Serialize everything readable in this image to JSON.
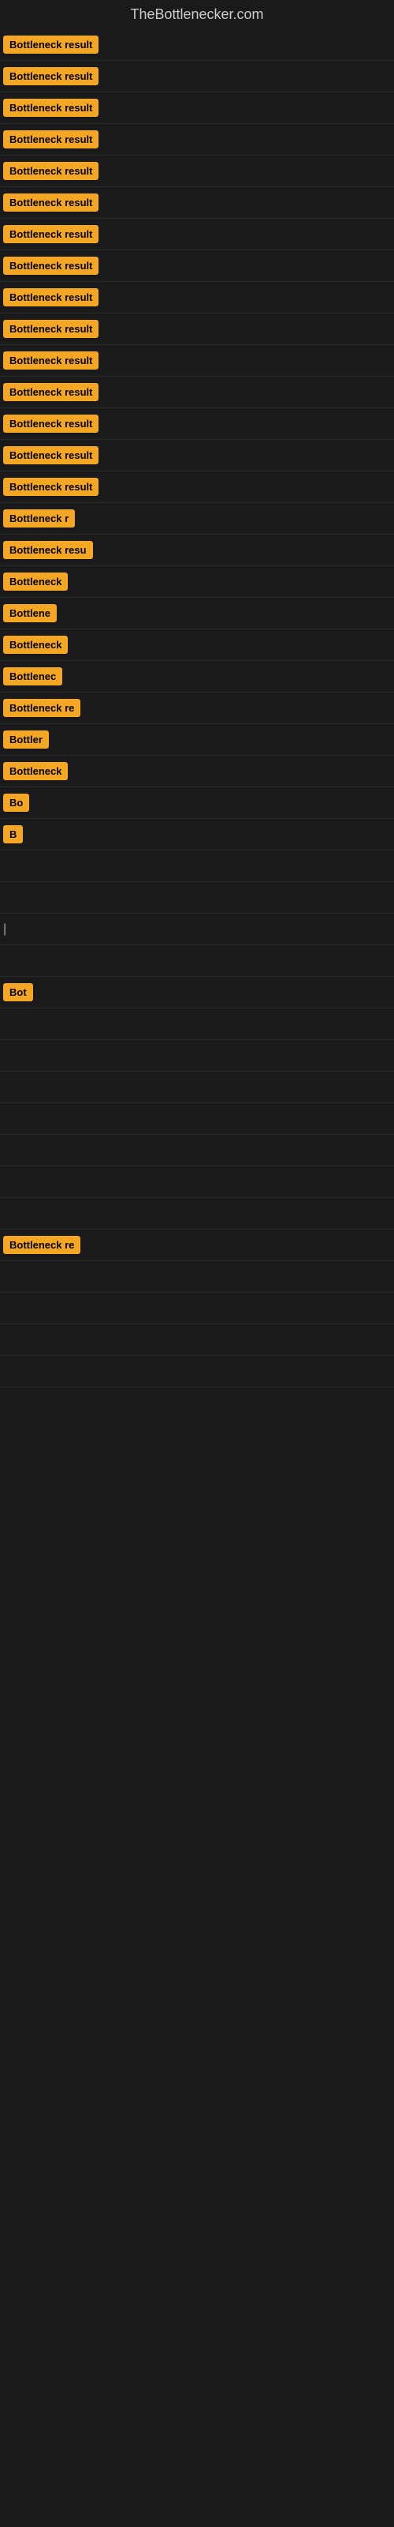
{
  "site": {
    "title": "TheBottlenecker.com"
  },
  "rows": [
    {
      "label": "Bottleneck result",
      "width": 140
    },
    {
      "label": "Bottleneck result",
      "width": 145
    },
    {
      "label": "Bottleneck result",
      "width": 140
    },
    {
      "label": "Bottleneck result",
      "width": 138
    },
    {
      "label": "Bottleneck result",
      "width": 140
    },
    {
      "label": "Bottleneck result",
      "width": 135
    },
    {
      "label": "Bottleneck result",
      "width": 140
    },
    {
      "label": "Bottleneck result",
      "width": 140
    },
    {
      "label": "Bottleneck result",
      "width": 138
    },
    {
      "label": "Bottleneck result",
      "width": 140
    },
    {
      "label": "Bottleneck result",
      "width": 138
    },
    {
      "label": "Bottleneck result",
      "width": 135
    },
    {
      "label": "Bottleneck result",
      "width": 135
    },
    {
      "label": "Bottleneck result",
      "width": 135
    },
    {
      "label": "Bottleneck result",
      "width": 132
    },
    {
      "label": "Bottleneck r",
      "width": 90
    },
    {
      "label": "Bottleneck resu",
      "width": 105
    },
    {
      "label": "Bottleneck",
      "width": 80
    },
    {
      "label": "Bottlene",
      "width": 68
    },
    {
      "label": "Bottleneck",
      "width": 80
    },
    {
      "label": "Bottlenec",
      "width": 75
    },
    {
      "label": "Bottleneck re",
      "width": 98
    },
    {
      "label": "Bottler",
      "width": 58
    },
    {
      "label": "Bottleneck",
      "width": 80
    },
    {
      "label": "Bo",
      "width": 24
    },
    {
      "label": "B",
      "width": 12
    },
    {
      "label": "",
      "width": 0
    },
    {
      "label": "",
      "width": 0
    },
    {
      "label": "|",
      "width": 6
    },
    {
      "label": "",
      "width": 0
    },
    {
      "label": "Bot",
      "width": 30
    },
    {
      "label": "",
      "width": 0
    },
    {
      "label": "",
      "width": 0
    },
    {
      "label": "",
      "width": 0
    },
    {
      "label": "",
      "width": 0
    },
    {
      "label": "",
      "width": 0
    },
    {
      "label": "",
      "width": 0
    },
    {
      "label": "",
      "width": 0
    },
    {
      "label": "Bottleneck re",
      "width": 98
    },
    {
      "label": "",
      "width": 0
    },
    {
      "label": "",
      "width": 0
    },
    {
      "label": "",
      "width": 0
    },
    {
      "label": "",
      "width": 0
    }
  ],
  "colors": {
    "badge_bg": "#f5a623",
    "badge_text": "#000000",
    "background": "#1a1a1a",
    "title_text": "#cccccc"
  }
}
